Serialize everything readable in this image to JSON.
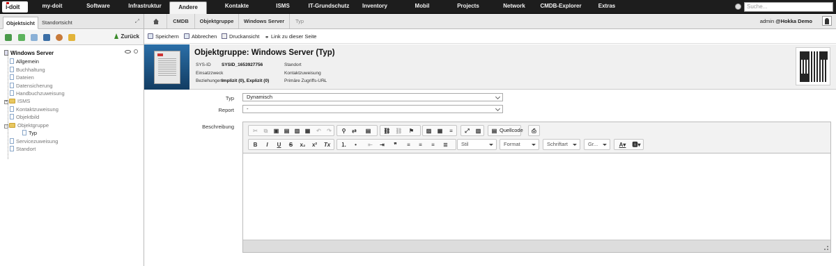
{
  "topnav": {
    "logo": "i-doit",
    "items": [
      "my-doit",
      "Software",
      "Infrastruktur",
      "Andere",
      "Kontakte",
      "ISMS",
      "IT-Grundschutz",
      "Inventory",
      "Mobil",
      "Projects",
      "Network",
      "CMDB-Explorer",
      "Extras"
    ],
    "active": "Andere",
    "search_placeholder": "Suche..."
  },
  "left": {
    "tabs": [
      "Objektsicht",
      "Standortsicht"
    ],
    "back_label": "Zurück",
    "tree": {
      "root": "Windows Server",
      "items": [
        "Allgemein",
        "Buchhaltung",
        "Dateien",
        "Datensicherung",
        "Handbuchzuweisung",
        "ISMS",
        "Kontaktzuweisung",
        "Objektbild",
        "Objektgruppe",
        "Typ",
        "Servicezuweisung",
        "Standort"
      ]
    }
  },
  "breadcrumb": {
    "items": [
      "CMDB",
      "Objektgruppe",
      "Windows Server",
      "Typ"
    ],
    "user": "admin",
    "tenant": "Hokka Demo"
  },
  "actions": {
    "save": "Speichern",
    "cancel": "Abbrechen",
    "print": "Druckansicht",
    "link": "Link zu dieser Seite"
  },
  "header": {
    "title": "Objektgruppe: Windows Server (Typ)",
    "sysid_label": "SYS-ID",
    "sysid_value": "SYSID_1653927756",
    "einsatz_label": "Einsatzzweck",
    "bez_label": "Beziehungen",
    "bez_value": "Implizit (0), Explizit (0)",
    "standort_label": "Standort",
    "kontakt_label": "Kontaktzuweisung",
    "url_label": "Primäre Zugriffs-URL",
    "url_value": "-"
  },
  "form": {
    "typ_label": "Typ",
    "typ_value": "Dynamisch",
    "report_label": "Report",
    "report_value": "-",
    "desc_label": "Beschreibung"
  },
  "editor": {
    "source_label": "Quellcode",
    "dropdowns": [
      "Stil",
      "Format",
      "Schriftart",
      "Gr..."
    ],
    "format_buttons": [
      "B",
      "I",
      "U",
      "S",
      "x₂",
      "x²",
      "Tx"
    ]
  }
}
